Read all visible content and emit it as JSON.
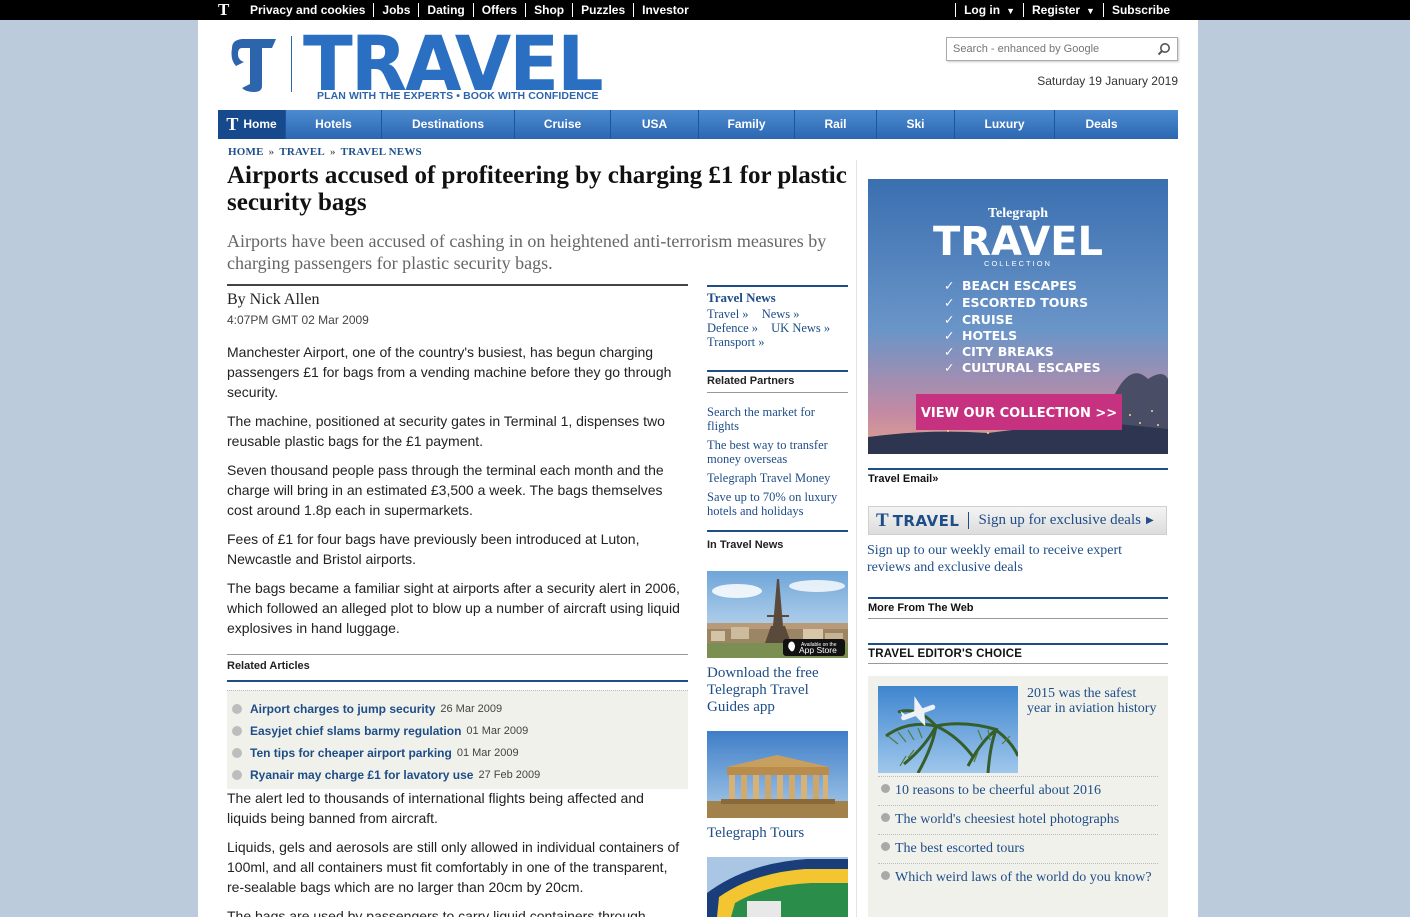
{
  "topbar": {
    "left_links": [
      "Privacy and cookies",
      "Jobs",
      "Dating",
      "Offers",
      "Shop",
      "Puzzles",
      "Investor"
    ],
    "right_links": [
      {
        "label": "Log in",
        "dropdown": true
      },
      {
        "label": "Register",
        "dropdown": true
      },
      {
        "label": "Subscribe",
        "dropdown": false
      }
    ]
  },
  "header": {
    "logo_text": "TRAVEL",
    "tagline": "PLAN WITH THE EXPERTS • BOOK WITH CONFIDENCE",
    "search_placeholder": "Search - enhanced by Google",
    "date": "Saturday 19 January 2019"
  },
  "nav": [
    "Home",
    "Hotels",
    "Destinations",
    "Cruise",
    "USA",
    "Family",
    "Rail",
    "Ski",
    "Luxury",
    "Deals"
  ],
  "breadcrumb": [
    "HOME",
    "TRAVEL",
    "TRAVEL NEWS"
  ],
  "article": {
    "headline": "Airports accused of profiteering by charging £1 for plastic security bags",
    "standfirst": "Airports have been accused of cashing in on heightened anti-terrorism measures by charging passengers for plastic security bags.",
    "byline": "By Nick Allen",
    "dateline": "4:07PM GMT 02 Mar 2009",
    "paragraphs_top": [
      "Manchester Airport, one of the country's busiest, has begun charging passengers £1 for bags from a vending machine before they go through security.",
      "The machine, positioned at security gates in Terminal 1, dispenses two reusable plastic bags for the £1 payment.",
      "Seven thousand people pass through the terminal each month and the charge will bring in an estimated £3,500 a week. The bags themselves cost around 1.8p each in supermarkets.",
      "Fees of £1 for four bags have previously been introduced at Luton, Newcastle and Bristol airports.",
      "The bags became a familiar sight at airports after a security alert in 2006, which followed an alleged plot to blow up a number of aircraft using liquid explosives in hand luggage."
    ],
    "paragraphs_bottom": [
      "The alert led to thousands of international flights being affected and liquids being banned from aircraft.",
      "Liquids, gels and aerosols are still only allowed in individual containers of 100ml, and all containers must fit comfortably in one of the transparent, re-sealable bags which are no larger than 20cm by 20cm.",
      "The bags are used by passengers to carry liquid containers through"
    ]
  },
  "related_articles": {
    "heading": "Related Articles",
    "items": [
      {
        "title": "Airport charges to jump security",
        "date": "26 Mar 2009"
      },
      {
        "title": "Easyjet chief slams barmy regulation",
        "date": "01 Mar 2009"
      },
      {
        "title": "Ten tips for cheaper airport parking",
        "date": "01 Mar 2009"
      },
      {
        "title": "Ryanair may charge £1 for lavatory use",
        "date": "27 Feb 2009"
      }
    ]
  },
  "middle": {
    "travel_news_heading": "Travel News",
    "travel_news_links": [
      "Travel »",
      "News »",
      "Defence »",
      "UK News »",
      "Transport »"
    ],
    "related_partners_heading": "Related Partners",
    "related_partners_links": [
      "Search the market for flights",
      "The best way to transfer money overseas",
      "Telegraph Travel Money",
      "Save up to 70% on luxury hotels and holidays"
    ],
    "in_travel_news_heading": "In Travel News",
    "app_badge": [
      "Available on the",
      "App Store"
    ],
    "promo1_caption": "Download the free Telegraph Travel Guides app",
    "promo2_caption": "Telegraph Tours"
  },
  "right": {
    "ad": {
      "brand_small": "Telegraph",
      "brand_big": "TRAVEL",
      "brand_sub": "COLLECTION",
      "checks": [
        "BEACH ESCAPES",
        "ESCORTED TOURS",
        "CRUISE",
        "HOTELS",
        "CITY BREAKS",
        "CULTURAL ESCAPES"
      ],
      "button": "VIEW OUR COLLECTION >>"
    },
    "email_heading": "Travel Email»",
    "signup_brand": "TRAVEL",
    "signup_cta": "Sign up for exclusive deals",
    "email_text": "Sign up to our weekly email to receive expert reviews and exclusive deals",
    "more_web_heading": "More From The Web",
    "editors_choice_heading": "TRAVEL EDITOR'S CHOICE",
    "editors_feature": "2015 was the safest year in aviation history",
    "editors_list": [
      "10 reasons to be cheerful about 2016",
      "The world's cheesiest hotel photographs",
      "The best escorted tours",
      "Which weird laws of the world do you know?"
    ]
  },
  "colors": {
    "brand_blue": "#2a6fc2",
    "link_blue": "#1e4d87",
    "nav_blue": "#3a7cc4",
    "page_bg": "#bccbdc",
    "ad_button_pink": "#c6327f"
  }
}
